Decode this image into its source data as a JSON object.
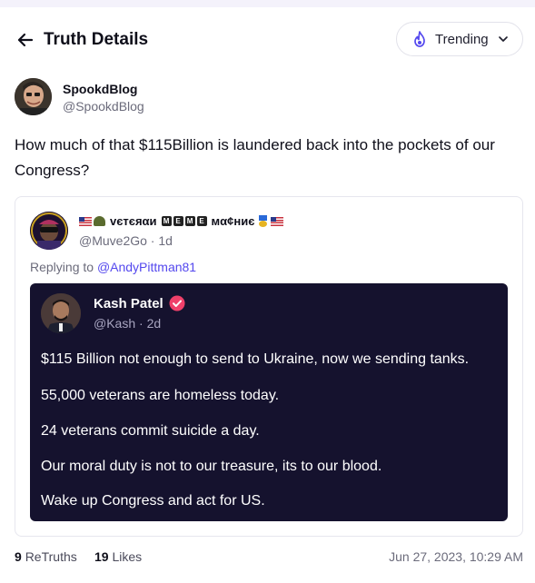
{
  "header": {
    "title": "Truth Details",
    "trending_label": "Trending"
  },
  "post": {
    "author_name": "SpookdBlog",
    "author_handle": "@SpookdBlog",
    "text": "How much of that $115Billion is laundered back into the pockets of our Congress?"
  },
  "quote": {
    "name_text": "ᴠєтєяαи",
    "name_badges": [
      "M",
      "E",
      "M",
      "E"
    ],
    "name_text2": "мα¢ниє",
    "handle_time": "@Muve2Go · 1d",
    "replying_prefix": "Replying to",
    "replying_handle": "@AndyPittman81",
    "embed": {
      "name": "Kash Patel",
      "handle_time": "@Kash · 2d",
      "lines": [
        "$115 Billion not enough to send to Ukraine, now we sending tanks.",
        "55,000 veterans are homeless today.",
        "24 veterans commit suicide a day.",
        "Our moral duty is not to our treasure, its to our blood.",
        "Wake up Congress and act for US."
      ]
    }
  },
  "footer": {
    "retruths_count": "9",
    "retruths_label": "ReTruths",
    "likes_count": "19",
    "likes_label": "Likes",
    "timestamp": "Jun 27, 2023, 10:29 AM"
  },
  "colors": {
    "accent": "#5448ee",
    "embed_bg": "#15122e",
    "verified": "#f0406a"
  },
  "icons": {
    "back": "arrow-left-icon",
    "trending": "flame-icon",
    "dropdown": "chevron-down-icon",
    "verified": "verified-badge-icon"
  }
}
